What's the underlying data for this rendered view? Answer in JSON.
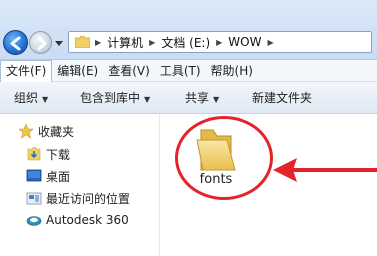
{
  "address": {
    "crumbs": [
      "计算机",
      "文档 (E:)",
      "WOW"
    ]
  },
  "menu": {
    "items": [
      "文件(F)",
      "编辑(E)",
      "查看(V)",
      "工具(T)",
      "帮助(H)"
    ]
  },
  "commands": {
    "organize": "组织",
    "include_library": "包含到库中",
    "share": "共享",
    "new_folder": "新建文件夹"
  },
  "nav": {
    "favorites": "收藏夹",
    "downloads": "下载",
    "desktop": "桌面",
    "recent": "最近访问的位置",
    "autodesk": "Autodesk 360"
  },
  "content": {
    "folder_name": "fonts"
  },
  "colors": {
    "annotation": "#e4242b",
    "folder": "#f2cf63"
  }
}
